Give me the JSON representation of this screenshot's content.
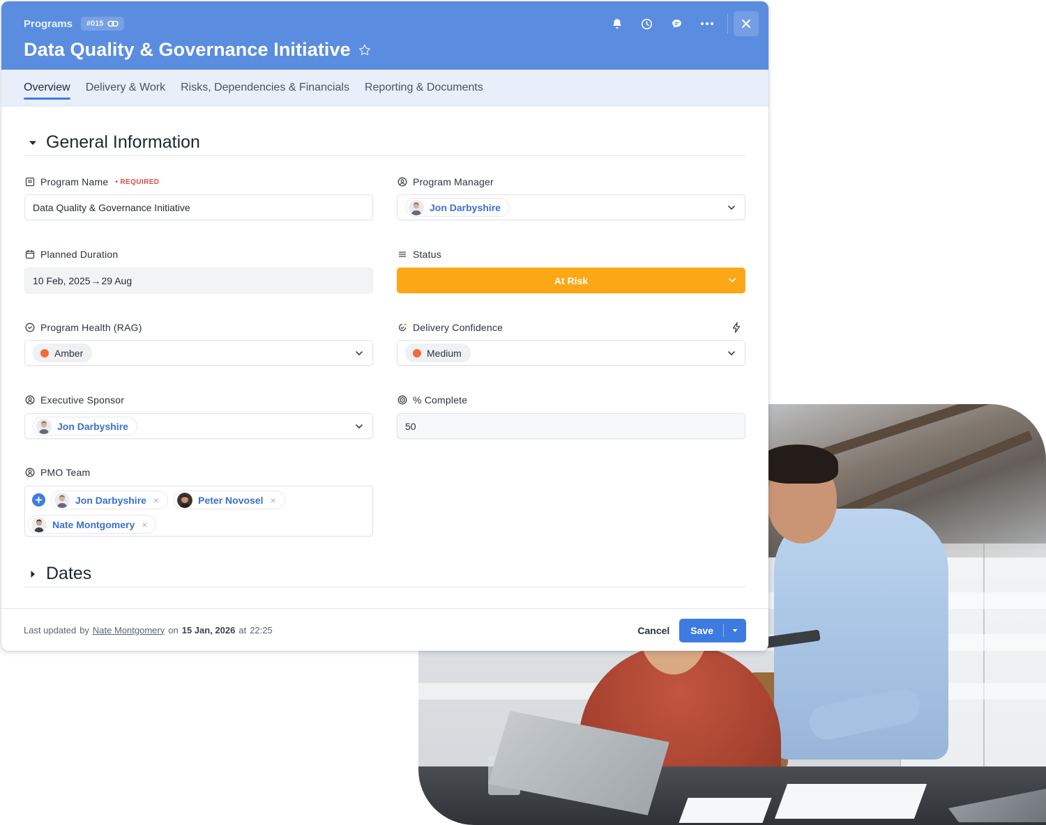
{
  "header": {
    "breadcrumb": "Programs",
    "record_id": "#015",
    "title": "Data Quality & Governance Initiative"
  },
  "tabs": [
    {
      "label": "Overview",
      "active": true
    },
    {
      "label": "Delivery & Work",
      "active": false
    },
    {
      "label": "Risks, Dependencies & Financials",
      "active": false
    },
    {
      "label": "Reporting & Documents",
      "active": false
    }
  ],
  "sections": {
    "general": "General Information",
    "dates": "Dates"
  },
  "fields": {
    "program_name": {
      "label": "Program Name",
      "required": "REQUIRED",
      "value": "Data Quality & Governance Initiative"
    },
    "program_manager": {
      "label": "Program Manager",
      "value": "Jon Darbyshire"
    },
    "planned_duration": {
      "label": "Planned Duration",
      "start": "10 Feb, 2025",
      "arrow": "→",
      "end": "29 Aug"
    },
    "status": {
      "label": "Status",
      "value": "At Risk",
      "color": "#fba716"
    },
    "program_health": {
      "label": "Program Health (RAG)",
      "value": "Amber",
      "dot_color": "#f56a36"
    },
    "delivery_confidence": {
      "label": "Delivery Confidence",
      "value": "Medium",
      "dot_color": "#f56a36"
    },
    "executive_sponsor": {
      "label": "Executive Sponsor",
      "value": "Jon Darbyshire"
    },
    "percent_complete": {
      "label": "% Complete",
      "value": "50"
    },
    "pmo_team": {
      "label": "PMO Team",
      "members": [
        "Jon Darbyshire",
        "Peter Novosel",
        "Nate Montgomery"
      ],
      "remove_glyph": "×"
    }
  },
  "footer": {
    "prefix": "Last updated",
    "by": "by",
    "user": "Nate Montgomery",
    "on": "on",
    "date": "15 Jan, 2026",
    "at": "at",
    "time": "22:25",
    "cancel_label": "Cancel",
    "save_label": "Save"
  },
  "colors": {
    "header_bg": "#5a8ddf",
    "accent": "#3d7be0",
    "tab_bar_bg": "#e8effb"
  },
  "icons": [
    "link-icon",
    "star-icon",
    "bell-icon",
    "clock-icon",
    "chat-icon",
    "more-icon",
    "close-icon",
    "chevron-down-icon",
    "lightning-icon"
  ]
}
